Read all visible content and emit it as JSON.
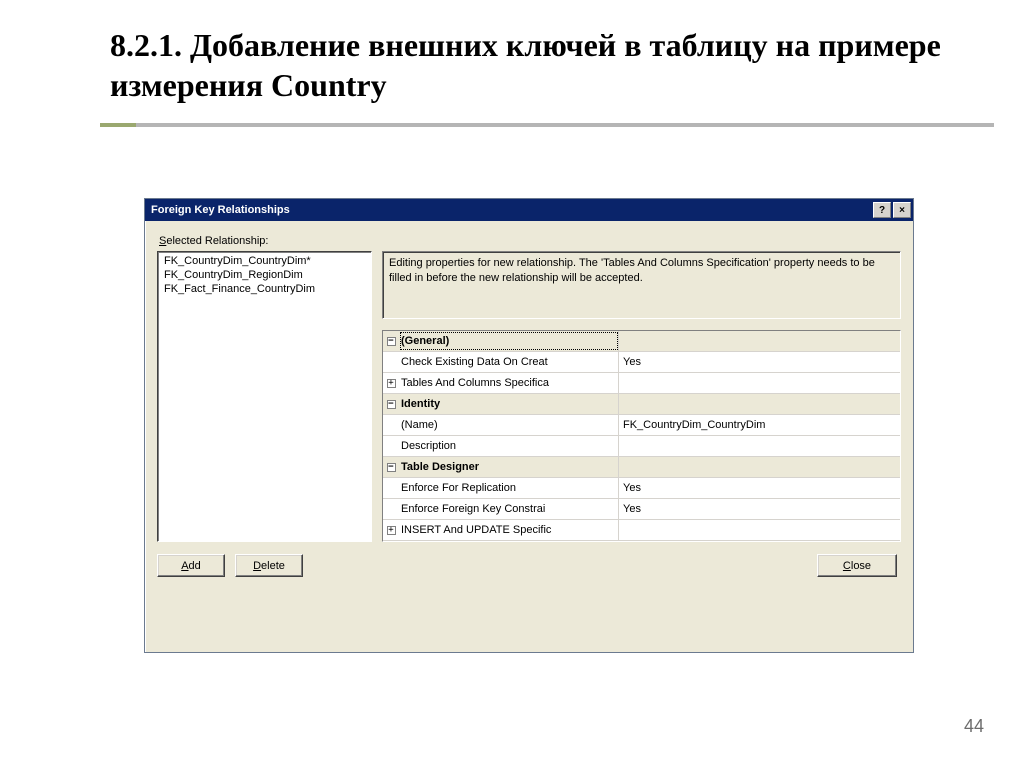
{
  "slide": {
    "title": "8.2.1. Добавление внешних ключей в таблицу на примере измерения Country",
    "page_number": "44"
  },
  "dialog": {
    "title": "Foreign Key Relationships",
    "selected_label_prefix": "S",
    "selected_label_rest": "elected Relationship:",
    "list": [
      "FK_CountryDim_CountryDim*",
      "FK_CountryDim_RegionDim",
      "FK_Fact_Finance_CountryDim"
    ],
    "description": "Editing properties for new relationship.  The 'Tables And Columns Specification' property needs to be filled in before the new relationship will be accepted.",
    "grid": {
      "cat_general": "(General)",
      "check_existing_label": "Check Existing Data On Creat",
      "check_existing_value": "Yes",
      "tables_columns_label": "Tables And Columns Specifica",
      "cat_identity": "Identity",
      "name_label": "(Name)",
      "name_value": "FK_CountryDim_CountryDim",
      "description_label": "Description",
      "cat_designer": "Table Designer",
      "enforce_repl_label": "Enforce For Replication",
      "enforce_repl_value": "Yes",
      "enforce_fk_label": "Enforce Foreign Key Constrai",
      "enforce_fk_value": "Yes",
      "insert_update_label": "INSERT And UPDATE Specific"
    },
    "buttons": {
      "add_prefix": "A",
      "add_rest": "dd",
      "delete_prefix": "D",
      "delete_rest": "elete",
      "close_prefix": "C",
      "close_rest": "lose"
    }
  }
}
